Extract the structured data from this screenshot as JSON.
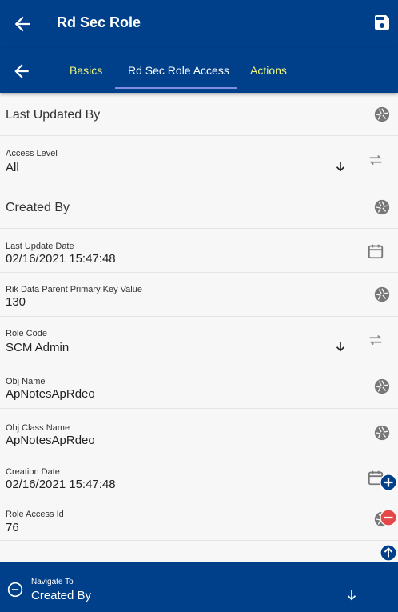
{
  "header": {
    "title": "Rd Sec Role"
  },
  "tabs": [
    {
      "label": "Basics"
    },
    {
      "label": "Rd Sec Role Access"
    },
    {
      "label": "Actions"
    }
  ],
  "fields": {
    "last_updated_by": {
      "label": "Last Updated By"
    },
    "access_level": {
      "label": "Access Level",
      "value": "All"
    },
    "created_by": {
      "label": "Created By"
    },
    "last_update_date": {
      "label": "Last Update Date",
      "value": "02/16/2021 15:47:48"
    },
    "rik_parent_key": {
      "label": "Rik Data Parent Primary Key Value",
      "value": "130"
    },
    "role_code": {
      "label": "Role Code",
      "value": "SCM Admin"
    },
    "obj_name": {
      "label": "Obj Name",
      "value": "ApNotesApRdeo"
    },
    "obj_class_name": {
      "label": "Obj Class Name",
      "value": "ApNotesApRdeo"
    },
    "creation_date": {
      "label": "Creation Date",
      "value": "02/16/2021 15:47:48"
    },
    "role_access_id": {
      "label": "Role Access Id",
      "value": "76"
    }
  },
  "footer": {
    "navigate_label": "Navigate To",
    "navigate_value": "Created By"
  },
  "colors": {
    "primary": "#003f8a",
    "tab_accent": "#eef57a",
    "fab_add": "#003f8a",
    "fab_remove": "#e54848"
  },
  "icons": [
    "back-arrow-icon",
    "save-icon",
    "aperture-icon",
    "swap-icon",
    "calendar-icon",
    "chevron-down-icon",
    "plus-icon",
    "minus-icon",
    "arrow-up-icon"
  ]
}
